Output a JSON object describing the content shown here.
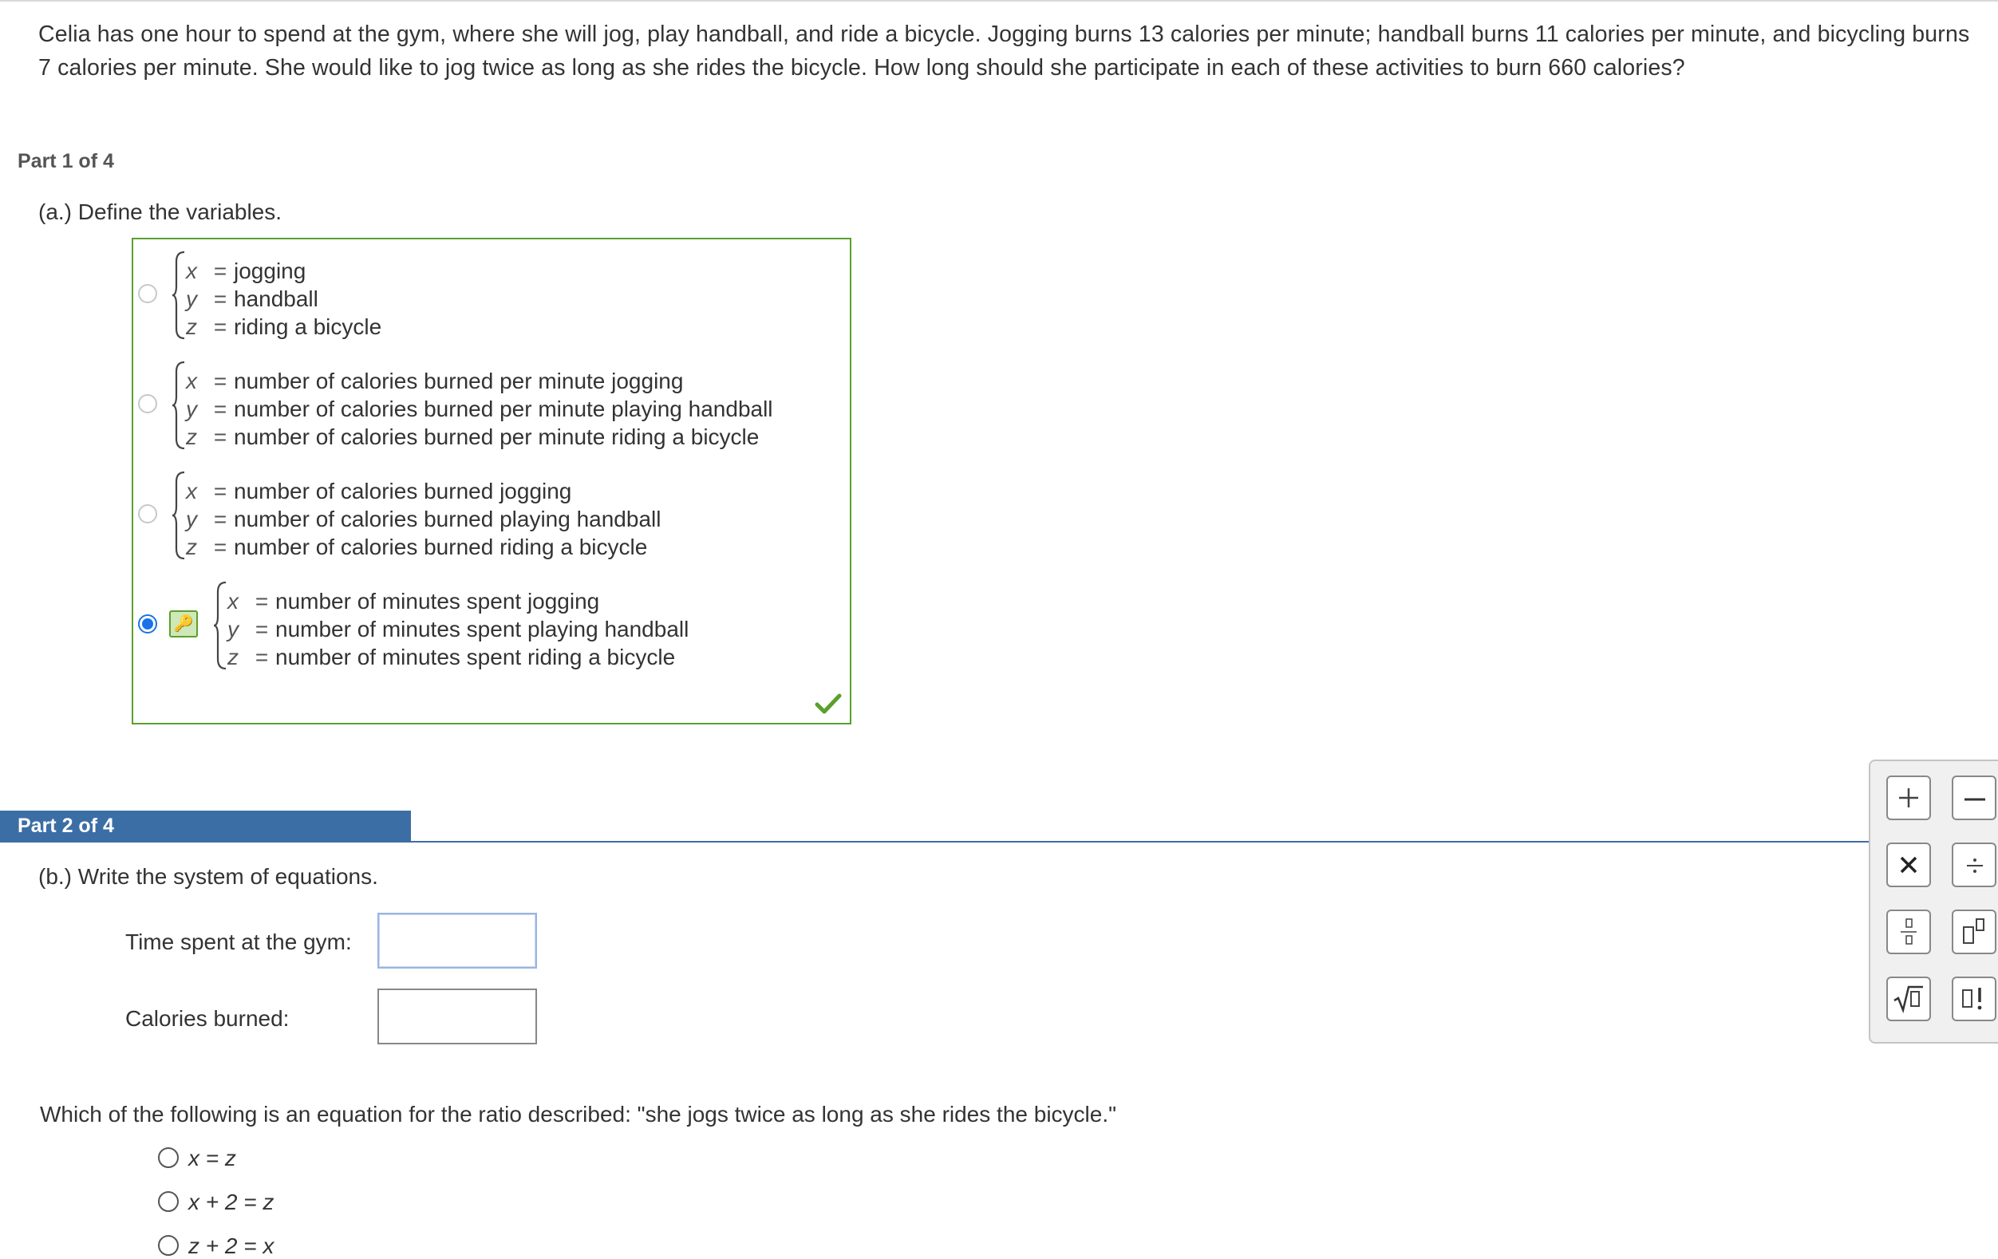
{
  "problem": {
    "text": "Celia has one hour to spend at the gym, where she will jog, play handball, and ride a bicycle. Jogging burns 13 calories per minute; handball burns 11 calories per minute, and bicycling burns 7 calories per minute. She would like to jog twice as long as she rides the bicycle. How long should she participate in each of these activities to burn 660 calories?"
  },
  "part1": {
    "label": "Part 1 of 4",
    "prompt": "(a.) Define the variables.",
    "options": [
      {
        "selected": false,
        "rows": [
          {
            "var": "x",
            "eq": "=",
            "desc": "jogging"
          },
          {
            "var": "y",
            "eq": "=",
            "desc": "handball"
          },
          {
            "var": "z",
            "eq": "=",
            "desc": "riding a bicycle"
          }
        ]
      },
      {
        "selected": false,
        "rows": [
          {
            "var": "x",
            "eq": "=",
            "desc": "number of calories burned per minute jogging"
          },
          {
            "var": "y",
            "eq": "=",
            "desc": "number of calories burned per minute playing handball"
          },
          {
            "var": "z",
            "eq": "=",
            "desc": "number of calories burned per minute riding a bicycle"
          }
        ]
      },
      {
        "selected": false,
        "rows": [
          {
            "var": "x",
            "eq": "=",
            "desc": "number of calories burned jogging"
          },
          {
            "var": "y",
            "eq": "=",
            "desc": "number of calories burned playing handball"
          },
          {
            "var": "z",
            "eq": "=",
            "desc": "number of calories burned riding a bicycle"
          }
        ]
      },
      {
        "selected": true,
        "rows": [
          {
            "var": "x",
            "eq": "=",
            "desc": "number of minutes spent jogging"
          },
          {
            "var": "y",
            "eq": "=",
            "desc": "number of minutes spent playing handball"
          },
          {
            "var": "z",
            "eq": "=",
            "desc": "number of minutes spent riding a bicycle"
          }
        ]
      }
    ],
    "status_icon": "checkmark-icon",
    "status_color": "#5aa02c"
  },
  "part2": {
    "label": "Part 2 of 4",
    "prompt": "(b.) Write the system of equations.",
    "fields": [
      {
        "label": "Time spent at the gym:",
        "value": ""
      },
      {
        "label": "Calories burned:",
        "value": ""
      }
    ],
    "question": "Which of the following is an equation for the ratio described: \"she jogs twice as long as she rides the bicycle.\"",
    "choices": [
      "x = z",
      "x + 2 = z",
      "z + 2 = x"
    ]
  },
  "palette": {
    "buttons": [
      {
        "name": "plus-icon",
        "glyph": "+"
      },
      {
        "name": "minus-icon",
        "glyph": "−"
      },
      {
        "name": "times-icon",
        "glyph": "X"
      },
      {
        "name": "divide-icon",
        "glyph": "÷"
      },
      {
        "name": "fraction-icon",
        "glyph": ""
      },
      {
        "name": "exponent-icon",
        "glyph": ""
      },
      {
        "name": "square-root-icon",
        "glyph": ""
      },
      {
        "name": "factorial-icon",
        "glyph": "!"
      }
    ]
  },
  "colors": {
    "part_header": "#3c6ea6",
    "correct_border": "#5aa02c",
    "selected_radio": "#1a73e8"
  }
}
